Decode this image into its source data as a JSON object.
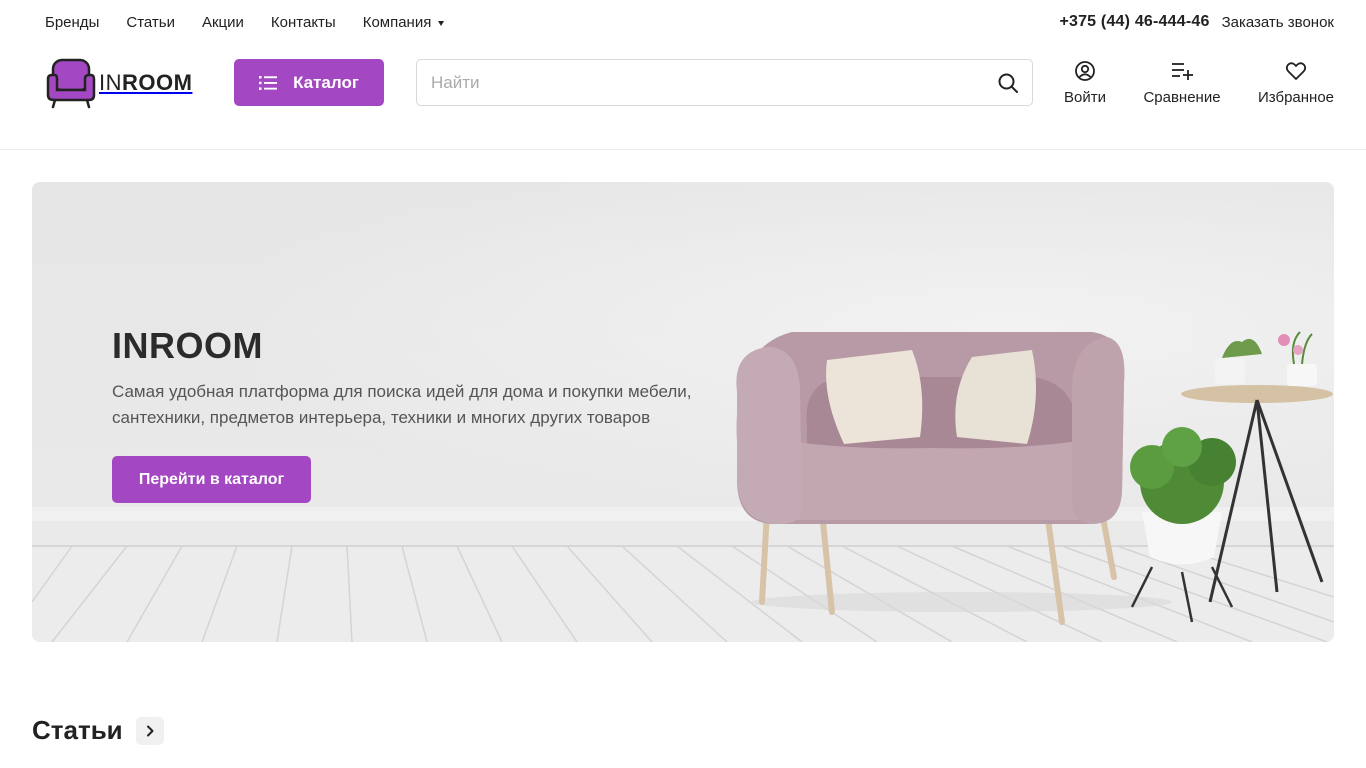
{
  "topnav": {
    "items": [
      "Бренды",
      "Статьи",
      "Акции",
      "Контакты",
      "Компания"
    ]
  },
  "contact": {
    "phone": "+375 (44) 46-444-46",
    "callback": "Заказать звонок"
  },
  "logo": {
    "prefix": "IN",
    "suffix": "ROOM"
  },
  "header": {
    "catalog_label": "Каталог",
    "search_placeholder": "Найти",
    "login_label": "Войти",
    "compare_label": "Сравнение",
    "favorites_label": "Избранное"
  },
  "hero": {
    "title": "INROOM",
    "text": "Самая удобная платформа для поиска идей для дома и покупки мебели, сантехники, предметов интерьера, техники и многих других товаров",
    "button": "Перейти в каталог"
  },
  "articles": {
    "title": "Статьи"
  },
  "colors": {
    "accent": "#a347c2",
    "text": "#222222",
    "banner_bg": "#e8e8e8"
  },
  "icons": [
    "list-icon",
    "search-icon",
    "user-icon",
    "compare-icon",
    "heart-icon",
    "chevron-right-icon",
    "caret-down-icon"
  ]
}
